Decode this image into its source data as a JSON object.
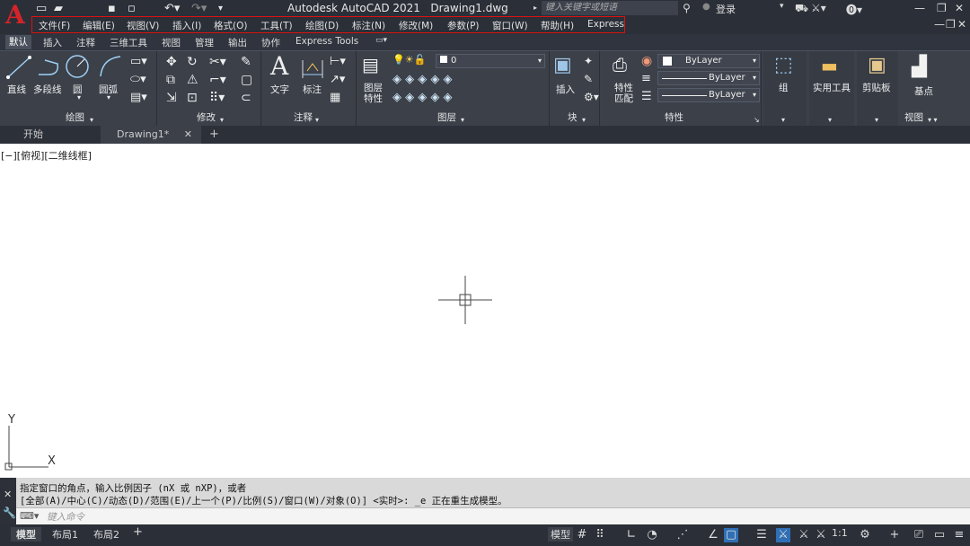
{
  "app": {
    "title": "Autodesk AutoCAD 2021",
    "file": "Drawing1.dwg",
    "search_placeholder": "键入关键字或短语",
    "login": "登录"
  },
  "menubar": [
    "文件(F)",
    "编辑(E)",
    "视图(V)",
    "插入(I)",
    "格式(O)",
    "工具(T)",
    "绘图(D)",
    "标注(N)",
    "修改(M)",
    "参数(P)",
    "窗口(W)",
    "帮助(H)",
    "Express"
  ],
  "ribbon_tabs": [
    "默认",
    "插入",
    "注释",
    "三维工具",
    "视图",
    "管理",
    "输出",
    "协作",
    "Express Tools"
  ],
  "panels": {
    "draw": {
      "label": "绘图",
      "buttons": [
        "直线",
        "多段线",
        "圆",
        "圆弧"
      ]
    },
    "modify": {
      "label": "修改"
    },
    "annotation": {
      "label": "注释",
      "buttons": [
        "文字",
        "标注"
      ]
    },
    "layers": {
      "label": "图层",
      "button": "图层\n特性",
      "layer_name": "0"
    },
    "block": {
      "label": "块",
      "button": "插入"
    },
    "properties": {
      "label": "特性",
      "button": "特性\n匹配",
      "color": "ByLayer",
      "linetype": "ByLayer",
      "lineweight": "ByLayer"
    },
    "group": {
      "label": "组"
    },
    "utilities": {
      "label": "实用工具"
    },
    "clipboard": {
      "label": "剪贴板"
    },
    "view": {
      "label": "视图",
      "button": "基点"
    }
  },
  "doc_tabs": {
    "start": "开始",
    "drawing": "Drawing1*"
  },
  "viewport_label": "[−][俯视][二维线框]",
  "ucs": {
    "x": "X",
    "y": "Y"
  },
  "command": {
    "line1": "指定窗口的角点，输入比例因子 (nX 或 nXP)，或者",
    "line2": "[全部(A)/中心(C)/动态(D)/范围(E)/上一个(P)/比例(S)/窗口(W)/对象(O)] <实时>: _e 正在重生成模型。",
    "placeholder": "键入命令"
  },
  "status": {
    "tabs": [
      "模型",
      "布局1",
      "布局2"
    ],
    "model": "模型",
    "scale": "1:1"
  },
  "colors": {
    "accent_red": "#d11e23",
    "ribbon_bg": "#3b4049",
    "titlebar_bg": "#2b2f38",
    "menu_highlight": "#dd1111"
  }
}
